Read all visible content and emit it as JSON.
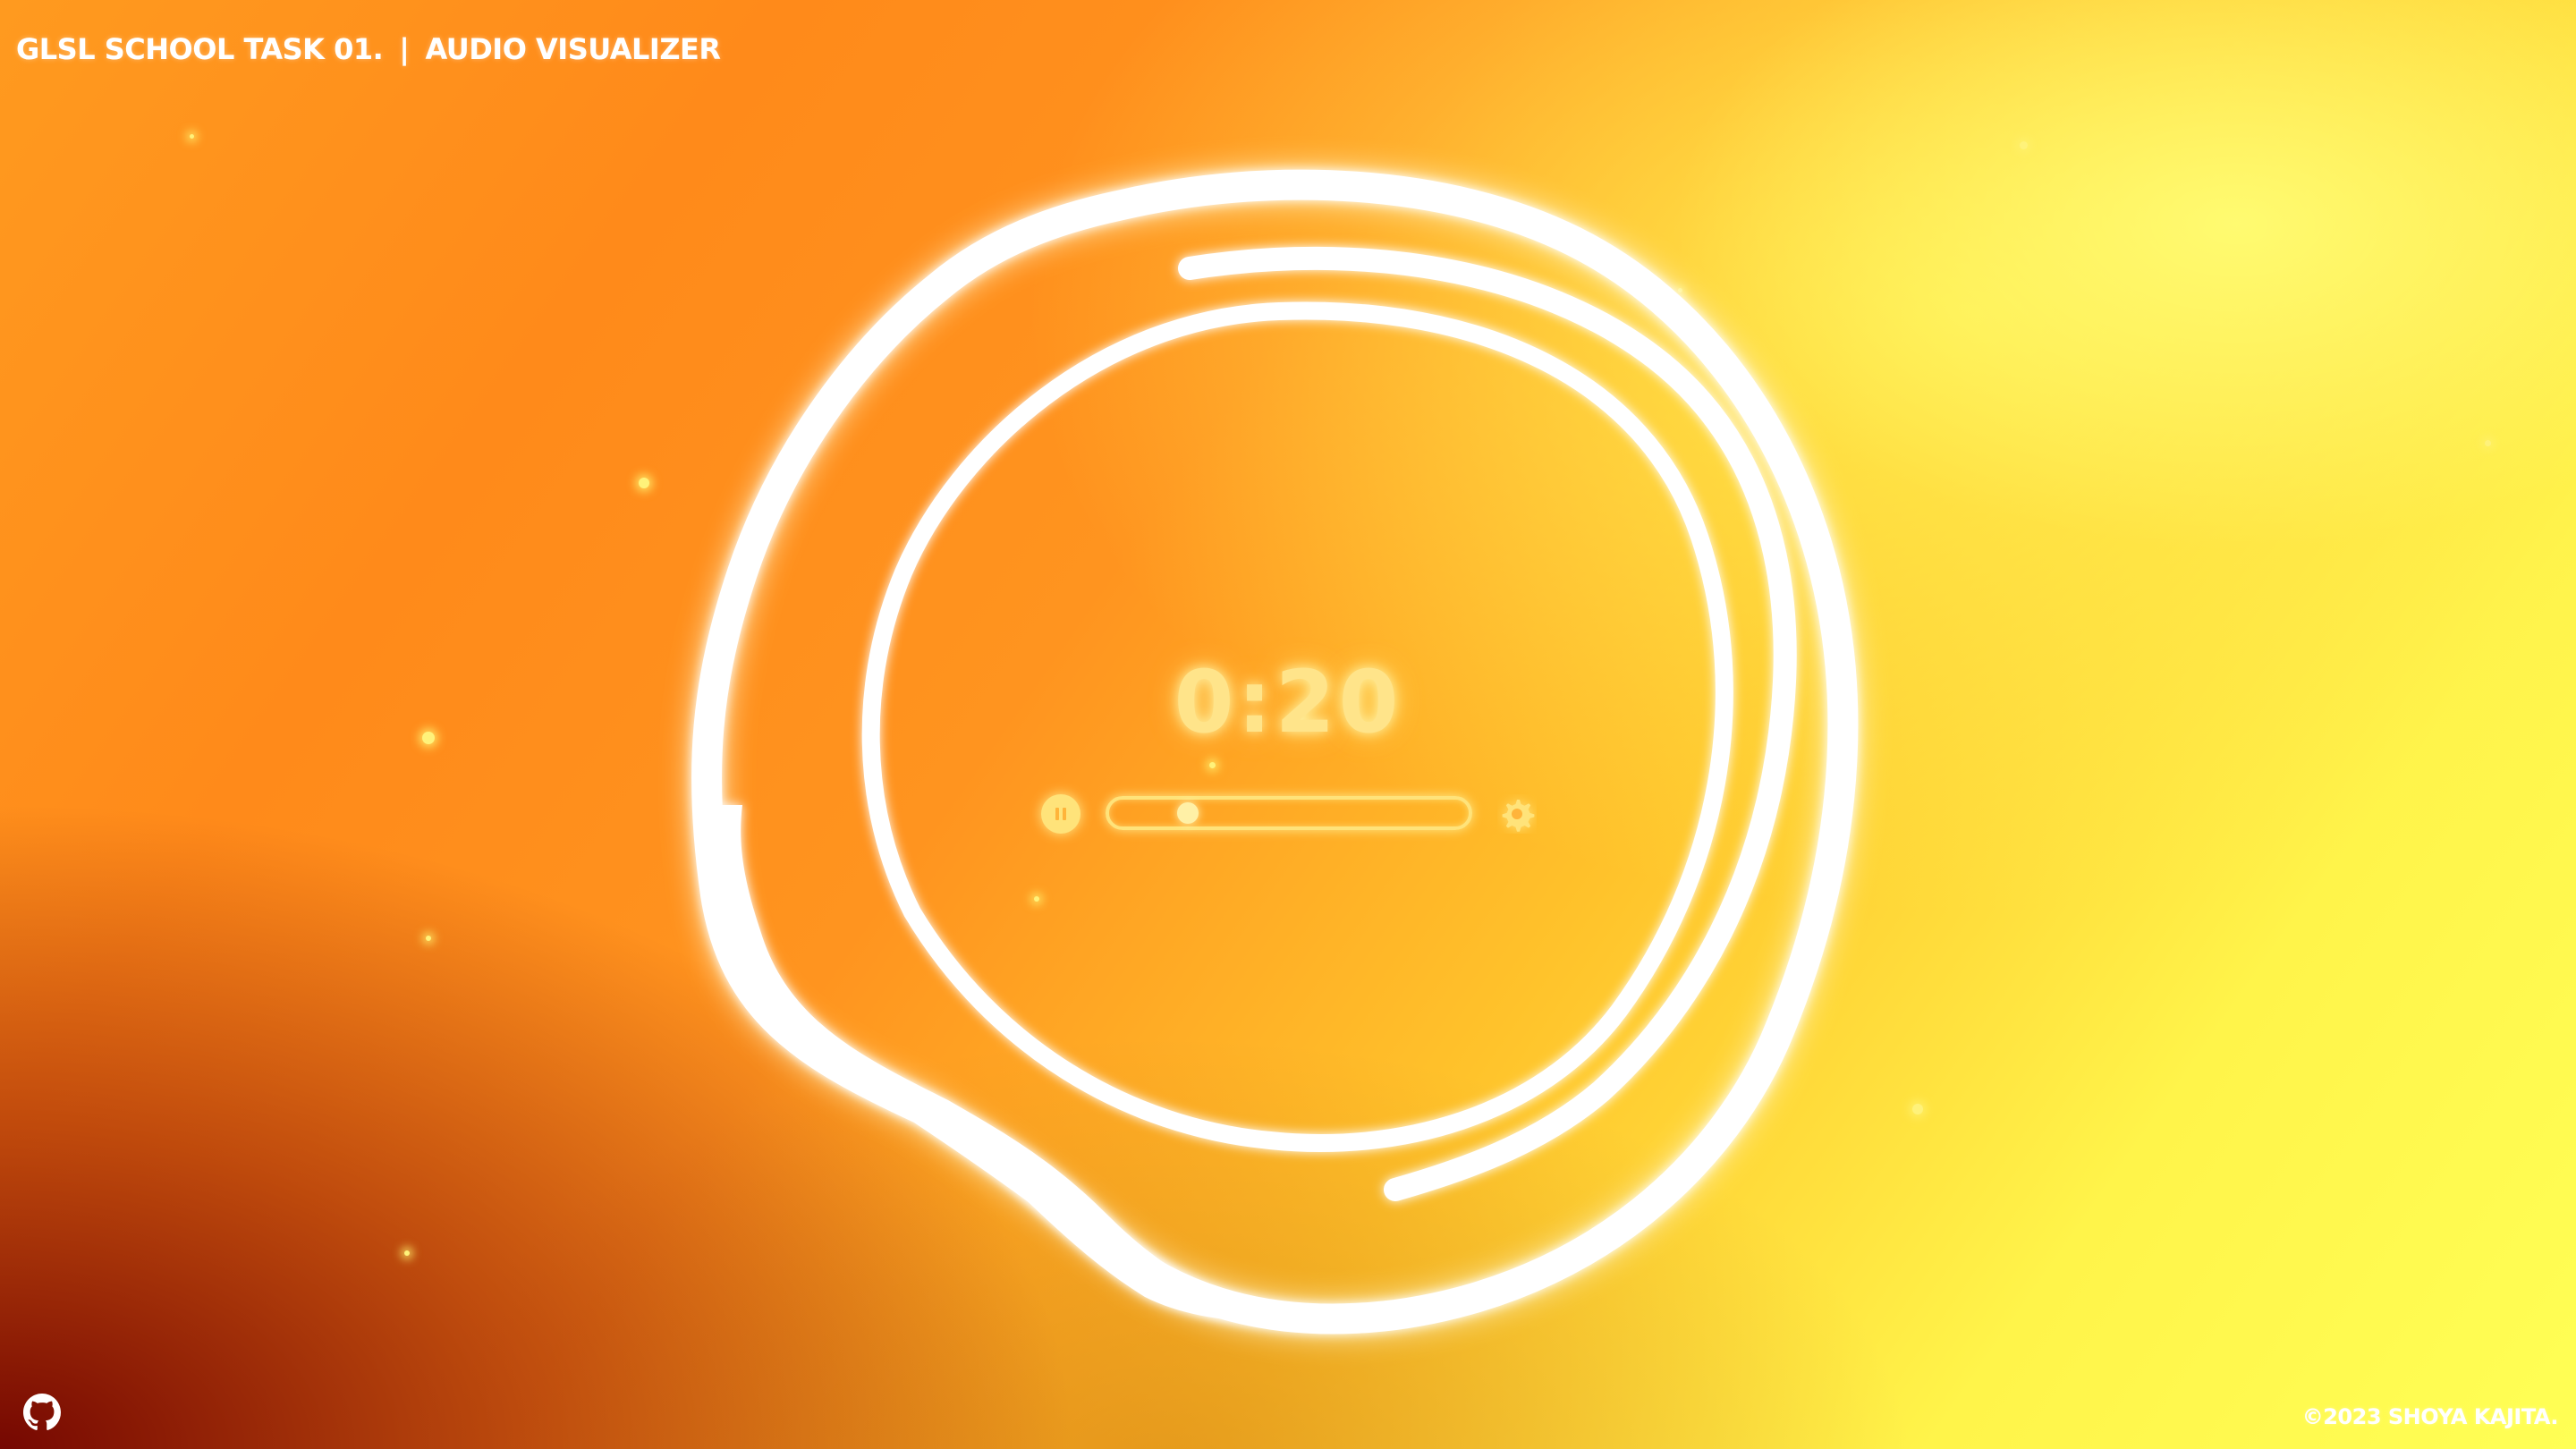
{
  "header": {
    "task_label": "GLSL SCHOOL TASK 01.",
    "separator": "|",
    "subtitle": "AUDIO VISUALIZER"
  },
  "player": {
    "time": "0:20",
    "progress": 0.2,
    "pause_icon": "pause-icon",
    "settings_icon": "gear-icon"
  },
  "footer": {
    "github_icon": "github-icon",
    "copyright": "©2023 SHOYA KAJITA."
  },
  "colors": {
    "accent_glow": "#ffe37a",
    "ring": "#ffffff",
    "bg_warm": "#ff8a1a",
    "bg_bright": "#ffff55",
    "bg_dark": "#6e0000"
  }
}
